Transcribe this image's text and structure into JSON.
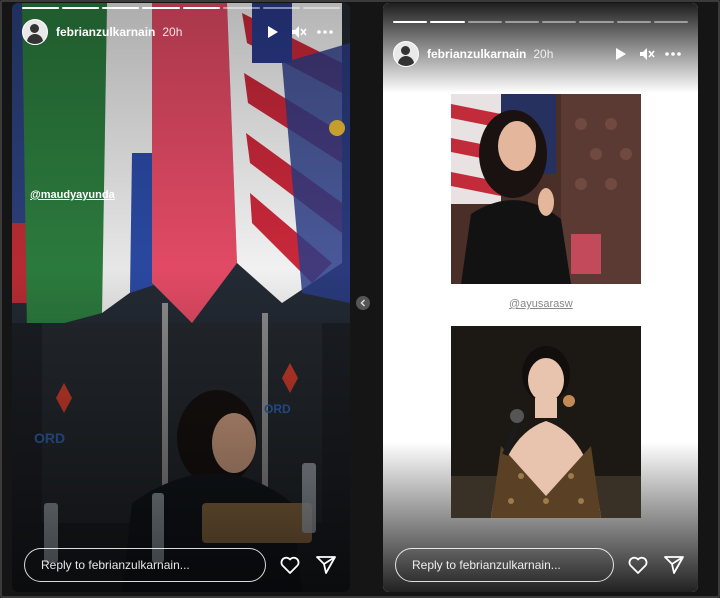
{
  "stories": [
    {
      "username": "febrianzulkarnain",
      "time": "20h",
      "mention": "@maudyayunda",
      "reply_placeholder": "Reply to febrianzulkarnain..."
    },
    {
      "username": "febrianzulkarnain",
      "time": "20h",
      "mention": "@ayusarasw",
      "reply_placeholder": "Reply to febrianzulkarnain..."
    }
  ],
  "icons": {
    "play": "play-icon",
    "mute": "mute-icon",
    "more": "more-icon",
    "like": "heart-icon",
    "send": "send-icon",
    "nav": "chevron-left-icon"
  }
}
